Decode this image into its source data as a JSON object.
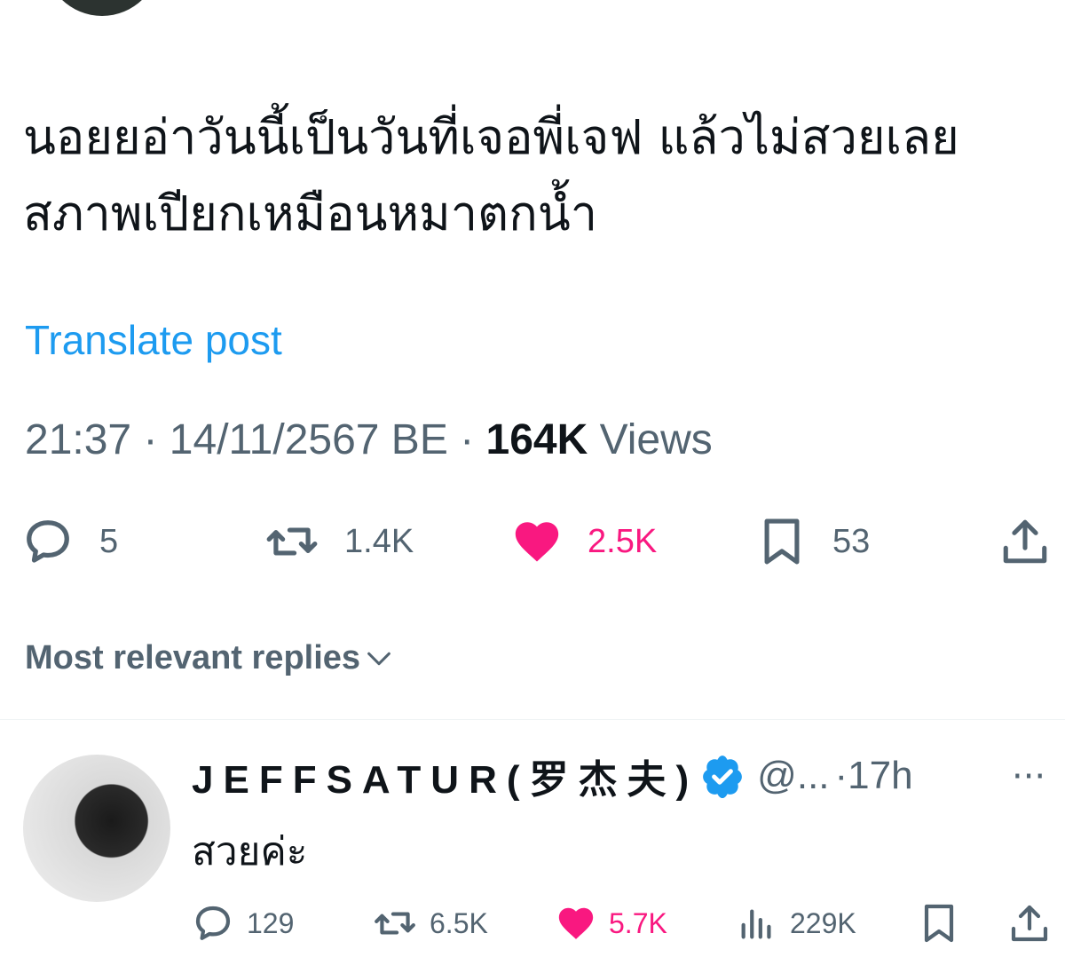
{
  "post": {
    "text": "นอยยอ่าวันนี้เป็นวันที่เจอพี่เจฟ แล้วไม่สวยเลย\nสภาพเปียกเหมือนหมาตกน้ำ",
    "translate_label": "Translate post",
    "time": "21:37",
    "date": "14/11/2567 BE",
    "separator": "·",
    "views_count": "164K",
    "views_label": "Views",
    "replies": "5",
    "reposts": "1.4K",
    "likes": "2.5K",
    "bookmarks": "53",
    "like_color": "#f91880"
  },
  "replies_sort": {
    "label": "Most relevant replies"
  },
  "reply": {
    "name": "JEFFSATUR(罗杰夫)",
    "handle": "@...",
    "time": "·17h",
    "more": "···",
    "text": "สวยค่ะ",
    "replies": "129",
    "reposts": "6.5K",
    "likes": "5.7K",
    "views": "229K"
  },
  "icons": {
    "reply": "speech-bubble-icon",
    "repost": "repost-arrows-icon",
    "like": "heart-icon",
    "bookmark": "bookmark-icon",
    "share": "share-upload-icon",
    "views": "bar-chart-icon",
    "verified": "verified-badge-icon",
    "sort": "chevron-down-icon"
  },
  "colors": {
    "link": "#1d9bf0",
    "secondary_text": "#536471",
    "verified": "#1d9bf0"
  }
}
